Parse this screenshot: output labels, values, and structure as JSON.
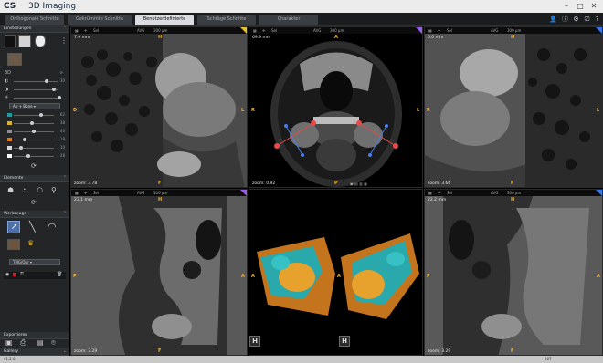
{
  "app": {
    "logo": "CS",
    "title": "3D Imaging"
  },
  "window_controls": [
    "–",
    "□",
    "✕"
  ],
  "tabs": [
    {
      "label": "Orthogonale Schnitte",
      "active": false
    },
    {
      "label": "Gekrümmte Schnitte",
      "active": false
    },
    {
      "label": "Benutzerdefinierte Schnitte",
      "active": true
    },
    {
      "label": "Schräge Schnitte",
      "active": false
    },
    {
      "label": "Charakter",
      "active": false
    }
  ],
  "left_panel": {
    "settings_title": "Einstellungen",
    "slider_value_30": "30",
    "dropdown_label": "Air + Bone",
    "tissue_rows": [
      {
        "color": "#1f9aa3",
        "value": "62"
      },
      {
        "color": "#d8b02a",
        "value": "38"
      },
      {
        "color": "#8a8f94",
        "value": "40"
      },
      {
        "color": "#e07a1c",
        "value": "18"
      },
      {
        "color": "#d8d8d8",
        "value": "10"
      },
      {
        "color": "#ffffff",
        "value": "28"
      }
    ],
    "elements_title": "Elemente",
    "tools_title": "Werkzeuge",
    "preset_label": "TMG/Ohr",
    "export_title": "Exportieren",
    "gallery_title": "Gallery"
  },
  "viewports": [
    {
      "id": "top-left",
      "distance": "7.9 mm",
      "zoom": "zoom: 3.78",
      "top_letter": "H",
      "left_letter": "D",
      "right_letter": "L",
      "bottom_letter": "F",
      "corner_color": "#e6c12f"
    },
    {
      "id": "top-center",
      "distance": "69.9 mm",
      "zoom": "zoom: 0.92",
      "top_letter": "A",
      "left_letter": "R",
      "right_letter": "L",
      "bottom_letter": "P",
      "corner_color": "#9b5ce8"
    },
    {
      "id": "top-right",
      "distance": "6.0 mm",
      "zoom": "zoom: 3.66",
      "top_letter": "H",
      "left_letter": "R",
      "right_letter": "L",
      "bottom_letter": "F",
      "corner_color": "#3575e5"
    },
    {
      "id": "bottom-left",
      "distance": "23.1 mm",
      "zoom": "zoom: 3.29",
      "top_letter": "H",
      "left_letter": "P",
      "right_letter": "A",
      "bottom_letter": "F",
      "corner_color": "#9b5ce8"
    },
    {
      "id": "bottom-center",
      "distance": "",
      "zoom": "",
      "top_letter": "",
      "left_letter": "A",
      "right_letter": "A",
      "bottom_letter": "",
      "corner_color": ""
    },
    {
      "id": "bottom-right",
      "distance": "22.2 mm",
      "zoom": "zoom: 3.29",
      "top_letter": "H",
      "left_letter": "P",
      "right_letter": "A",
      "bottom_letter": "F",
      "corner_color": "#3575e5"
    }
  ],
  "toolbar": {
    "avg": "AVG",
    "mm": "300 µm",
    "sel": "Sel"
  },
  "badges": {
    "h": "H"
  },
  "statusbar": {
    "version": "v1.2.0",
    "right": "267"
  }
}
